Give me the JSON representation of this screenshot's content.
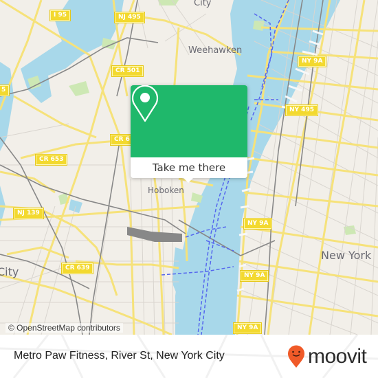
{
  "map": {
    "colors": {
      "land": "#f2efe9",
      "water": "#a8d8ea",
      "park": "#cde8b4",
      "road_major": "#f6e27a",
      "road_minor": "#d9d5cf",
      "rail": "#888888",
      "ferry": "#5566ee",
      "shield": "#f3d92f"
    },
    "road_shields": [
      {
        "label": "I 95"
      },
      {
        "label": "NJ 495"
      },
      {
        "label": "CR 501"
      },
      {
        "label": "CR 6"
      },
      {
        "label": "5"
      },
      {
        "label": "CR 653"
      },
      {
        "label": "NJ 139"
      },
      {
        "label": "CR 639"
      },
      {
        "label": "NY 9A"
      },
      {
        "label": "NY 495"
      },
      {
        "label": "NY 9A"
      },
      {
        "label": "NY 9A"
      },
      {
        "label": "NY 9A"
      }
    ],
    "places": [
      {
        "label": "City"
      },
      {
        "label": "Weehawken"
      },
      {
        "label": "Hoboken"
      },
      {
        "label": "New York"
      },
      {
        "label": "City"
      }
    ],
    "attribution": "© OpenStreetMap contributors"
  },
  "popup": {
    "icon": "map-pin-icon",
    "button_label": "Take me there",
    "color": "#1fb86b"
  },
  "footer": {
    "title": "Metro Paw Fitness, River St, New York City",
    "logo_text": "moovit",
    "logo_icon": "moovit-pin-icon",
    "logo_color": "#f05a28"
  }
}
